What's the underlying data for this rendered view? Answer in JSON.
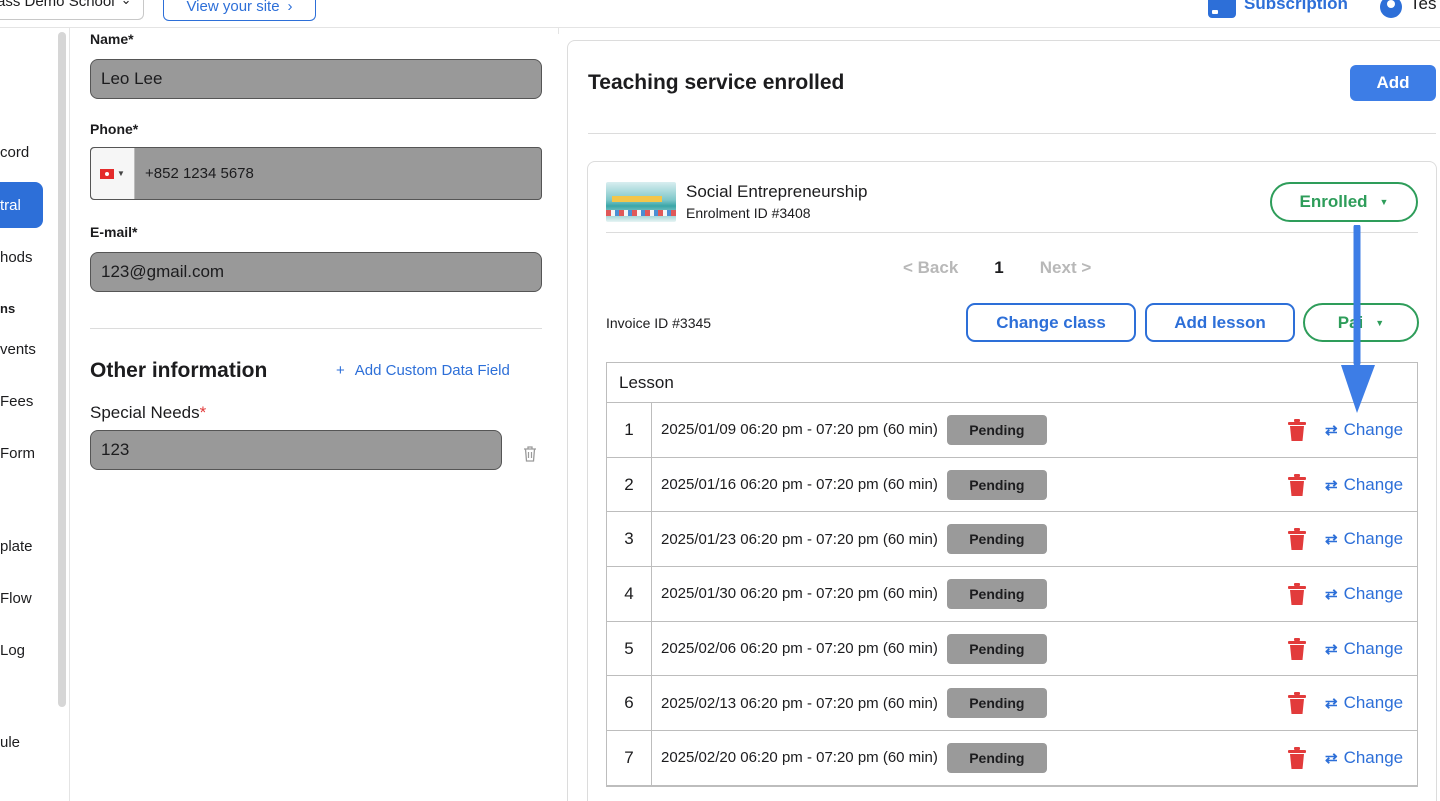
{
  "topbar": {
    "school_name": "ass Demo School",
    "view_site_label": "View your site",
    "subscription_label": "Subscription",
    "user_name": "Tes"
  },
  "sidebar": {
    "items": [
      {
        "label": "cord",
        "active": false
      },
      {
        "label": "tral",
        "active": true
      },
      {
        "label": "hods",
        "active": false
      },
      {
        "label": "ns",
        "heading": true
      },
      {
        "label": "vents",
        "active": false
      },
      {
        "label": "Fees",
        "active": false
      },
      {
        "label": "Form",
        "active": false
      },
      {
        "label": "plate",
        "active": false
      },
      {
        "label": "Flow",
        "active": false
      },
      {
        "label": "Log",
        "active": false
      },
      {
        "label": "ule",
        "active": false
      }
    ]
  },
  "form": {
    "name_label": "Name*",
    "name_value": "Leo Lee",
    "phone_label": "Phone*",
    "phone_value": "+852 1234 5678",
    "email_label": "E-mail*",
    "email_value": "123@gmail.com",
    "other_info_title": "Other information",
    "add_custom_label": "Add Custom Data Field",
    "add_custom_plus": "+",
    "special_needs_label": "Special Needs",
    "special_needs_required": "*",
    "special_needs_value": "123"
  },
  "panel": {
    "title": "Teaching service enrolled",
    "add_label": "Add",
    "course": {
      "name": "Social Entrepreneurship",
      "enrolment_id": "Enrolment ID #3408",
      "status_label": "Enrolled"
    },
    "pager": {
      "back": "< Back",
      "current": "1",
      "next": "Next >"
    },
    "invoice_id": "Invoice ID #3345",
    "change_class_label": "Change class",
    "add_lesson_label": "Add lesson",
    "paid_label": "Pai",
    "table_header": "Lesson",
    "change_label": "Change",
    "lessons": [
      {
        "num": "1",
        "date": "2025/01/09 06:20 pm - 07:20 pm (60 min)",
        "status": "Pending"
      },
      {
        "num": "2",
        "date": "2025/01/16 06:20 pm - 07:20 pm (60 min)",
        "status": "Pending"
      },
      {
        "num": "3",
        "date": "2025/01/23 06:20 pm - 07:20 pm (60 min)",
        "status": "Pending"
      },
      {
        "num": "4",
        "date": "2025/01/30 06:20 pm - 07:20 pm (60 min)",
        "status": "Pending"
      },
      {
        "num": "5",
        "date": "2025/02/06 06:20 pm - 07:20 pm (60 min)",
        "status": "Pending"
      },
      {
        "num": "6",
        "date": "2025/02/13 06:20 pm - 07:20 pm (60 min)",
        "status": "Pending"
      },
      {
        "num": "7",
        "date": "2025/02/20 06:20 pm - 07:20 pm (60 min)",
        "status": "Pending"
      }
    ]
  },
  "colors": {
    "accent": "#2d6fd8",
    "success": "#2e9d5a",
    "danger": "#e23b3b",
    "field_bg": "#999999"
  }
}
